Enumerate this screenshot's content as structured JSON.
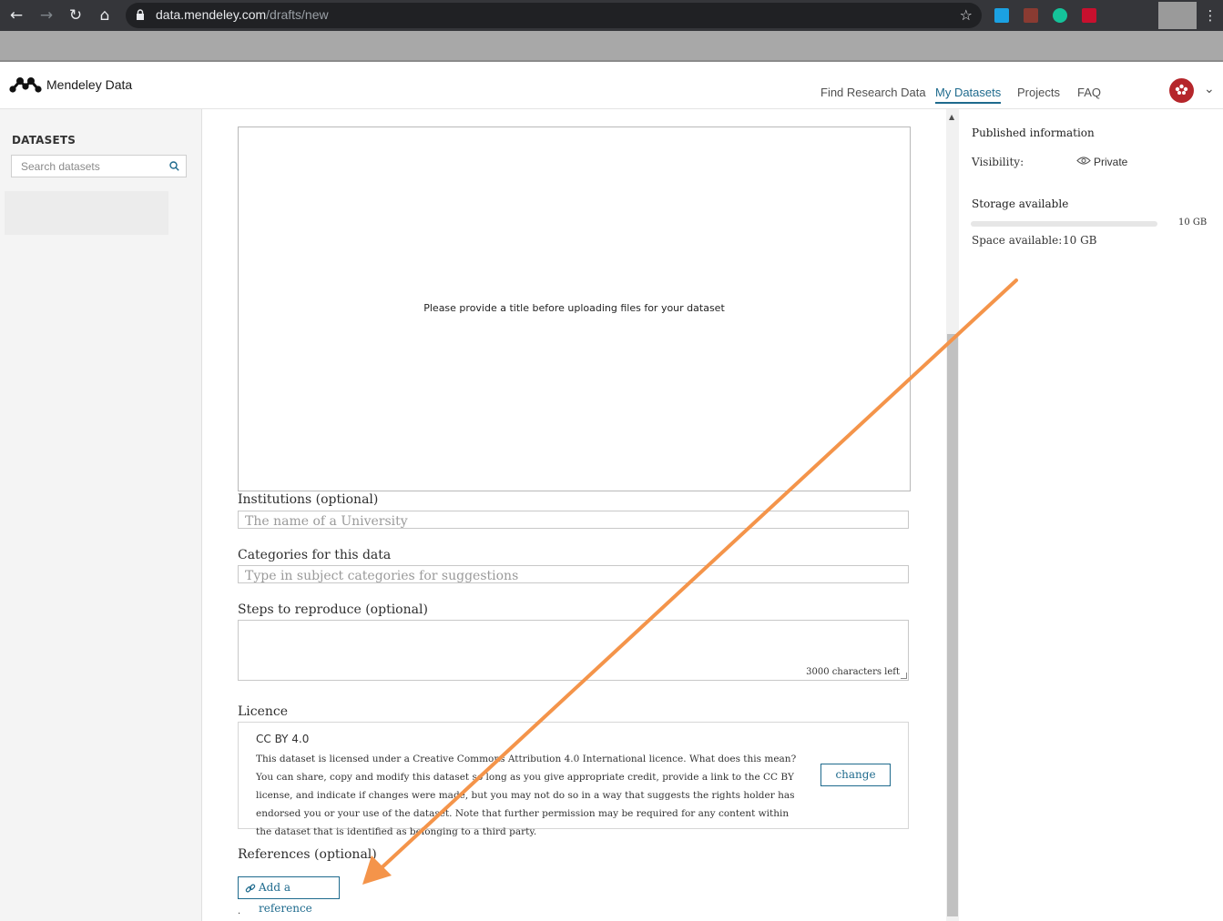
{
  "browser": {
    "url_host": "data.mendeley.com",
    "url_path": "/drafts/new",
    "extensions": [
      {
        "name": "windows-extension-icon",
        "color": "#1ba1e2"
      },
      {
        "name": "pdf-extension-icon",
        "color": "#8a3b32"
      },
      {
        "name": "grammarly-extension-icon",
        "color": "#15c39a"
      },
      {
        "name": "mendeley-extension-icon",
        "color": "#c8102e"
      }
    ]
  },
  "header": {
    "brand": "Mendeley Data",
    "nav": [
      {
        "label": "Find Research Data",
        "active": false
      },
      {
        "label": "My Datasets",
        "active": true
      },
      {
        "label": "Projects",
        "active": false
      },
      {
        "label": "FAQ",
        "active": false
      }
    ]
  },
  "sidebar": {
    "heading": "DATASETS",
    "search_placeholder": "Search datasets"
  },
  "form": {
    "upload_message": "Please provide a title before uploading files for your dataset",
    "institutions": {
      "label": "Institutions (optional)",
      "placeholder": "The name of a University"
    },
    "categories": {
      "label": "Categories for this data",
      "placeholder": "Type in subject categories for suggestions"
    },
    "steps": {
      "label": "Steps to reproduce (optional)",
      "chars_left": "3000 characters left"
    },
    "licence": {
      "label": "Licence",
      "name": "CC BY 4.0",
      "description": "This dataset is licensed under a Creative Commons Attribution 4.0 International licence. What does this mean? You can share, copy and modify this dataset so long as you give appropriate credit, provide a link to the CC BY license, and indicate if changes were made, but you may not do so in a way that suggests the rights holder has endorsed you or your use of the dataset. Note that further permission may be required for any content within the dataset that is identified as belonging to a third party.",
      "change_label": "change"
    },
    "references": {
      "label": "References (optional)",
      "add_label": "Add a reference"
    },
    "trailing_text": "."
  },
  "right_panel": {
    "published_title": "Published information",
    "visibility_label": "Visibility:",
    "visibility_value": "Private",
    "storage_title": "Storage available",
    "storage_total": "10 GB",
    "storage_used_fraction": 0,
    "space_label": "Space available:",
    "space_value": "10 GB"
  },
  "colors": {
    "accent": "#1e6a8d",
    "annotation_arrow": "#f4944a"
  }
}
